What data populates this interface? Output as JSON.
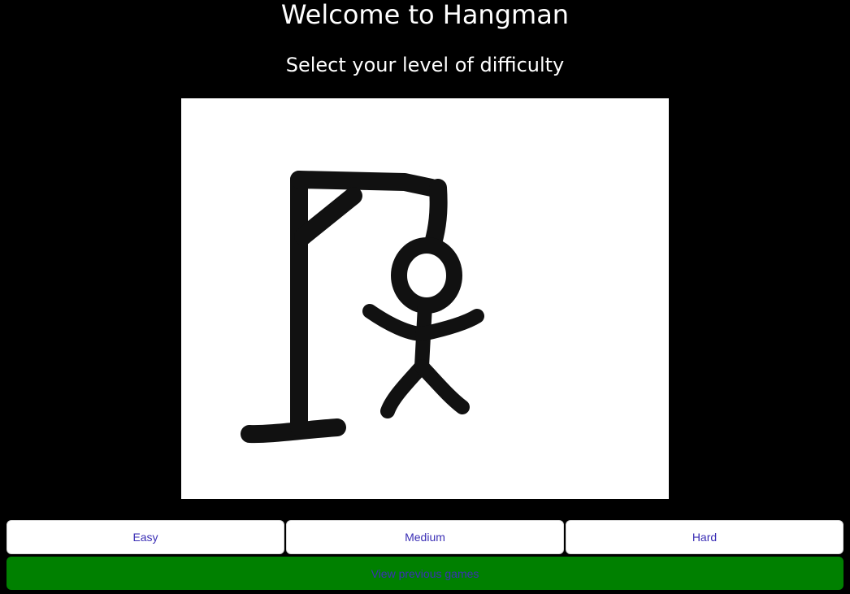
{
  "header": {
    "title": "Welcome to Hangman",
    "subtitle": "Select your level of difficulty"
  },
  "canvas": {
    "image": "hangman-drawing",
    "background": "#ffffff",
    "stroke_color": "#111111"
  },
  "difficulty": {
    "easy_label": "Easy",
    "medium_label": "Medium",
    "hard_label": "Hard"
  },
  "history": {
    "label": "View previous games",
    "color": "#008000"
  },
  "colors": {
    "page_background": "#000000",
    "button_text": "#3b2fb5",
    "text": "#ffffff"
  }
}
